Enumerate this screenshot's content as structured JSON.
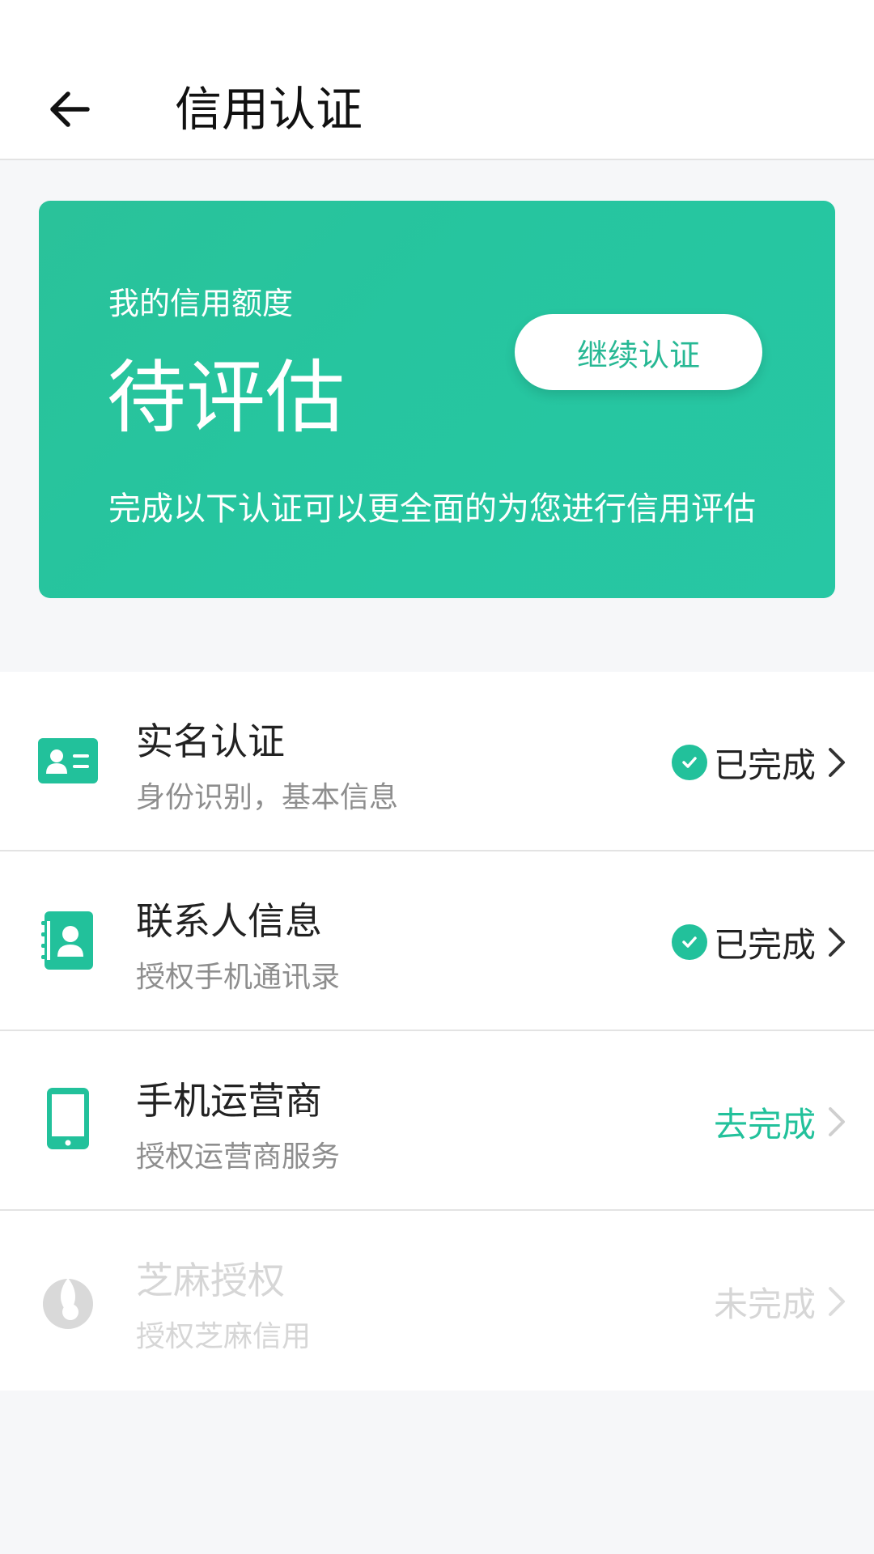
{
  "header": {
    "title": "信用认证"
  },
  "card": {
    "label": "我的信用额度",
    "value": "待评估",
    "description": "完成以下认证可以更全面的为您进行信用评估",
    "button_label": "继续认证"
  },
  "items": [
    {
      "title": "实名认证",
      "subtitle": "身份识别，基本信息",
      "status": "已完成",
      "icon": "id-card-icon"
    },
    {
      "title": "联系人信息",
      "subtitle": "授权手机通讯录",
      "status": "已完成",
      "icon": "contacts-book-icon"
    },
    {
      "title": "手机运营商",
      "subtitle": "授权运营商服务",
      "status": "去完成",
      "icon": "mobile-phone-icon"
    },
    {
      "title": "芝麻授权",
      "subtitle": "授权芝麻信用",
      "status": "未完成",
      "icon": "sesame-icon"
    }
  ],
  "colors": {
    "accent": "#22c19b",
    "completed_text": "#222222",
    "pending_text": "#22c19b",
    "disabled_text": "#d6d6d6"
  }
}
